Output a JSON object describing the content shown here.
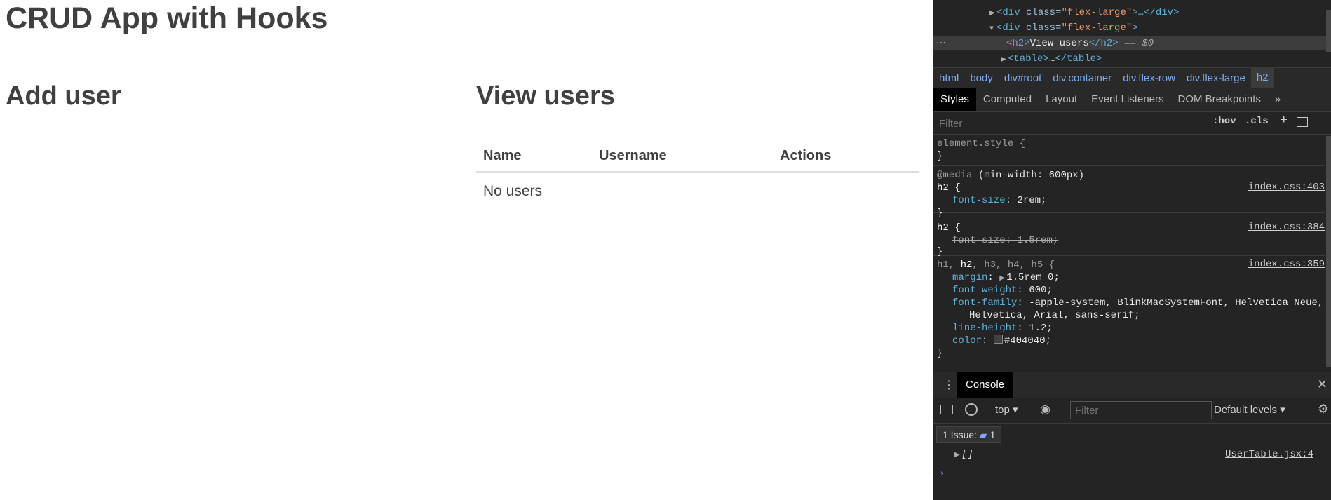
{
  "app": {
    "title": "CRUD App with Hooks",
    "add_heading": "Add user",
    "view_heading": "View users",
    "table": {
      "headers": [
        "Name",
        "Username",
        "Actions"
      ],
      "empty_message": "No users"
    }
  },
  "devtools": {
    "dom": {
      "line1": {
        "tag_open": "<div ",
        "attr": "class=",
        "value": "\"flex-large\"",
        "rest": ">…</div>"
      },
      "line2": {
        "tag_open": "<div ",
        "attr": "class=",
        "value": "\"flex-large\"",
        "close": ">"
      },
      "line3": {
        "open": "<h2>",
        "text": "View users",
        "close": "</h2>",
        "eq": " == ",
        "ref": "$0"
      },
      "line4": {
        "tag": "<table>",
        "ellipsis": "…",
        "close": "</table>"
      }
    },
    "breadcrumbs": [
      "html",
      "body",
      "div#root",
      "div.container",
      "div.flex-row",
      "div.flex-large",
      "h2"
    ],
    "tabs": [
      "Styles",
      "Computed",
      "Layout",
      "Event Listeners",
      "DOM Breakpoints"
    ],
    "tabs_more": "»",
    "styles_filter_placeholder": "Filter",
    "hov": ":hov",
    "cls": ".cls",
    "plus": "+",
    "rules": {
      "element_style": "element.style {",
      "close": "}",
      "media": "@media",
      "media_query": " (min-width: 600px)",
      "rule1": {
        "selector": "h2 {",
        "source": "index.css:403",
        "prop": "font-size",
        "value": "2rem;"
      },
      "rule2": {
        "selector": "h2 {",
        "source": "index.css:384",
        "prop": "font-size",
        "value": "1.5rem;"
      },
      "rule3": {
        "sel_h1": "h1, ",
        "sel_h2": "h2",
        "sel_rest": ", h3, h4, h5 {",
        "source": "index.css:359",
        "margin_prop": "margin",
        "margin_val": "1.5rem 0;",
        "fw_prop": "font-weight",
        "fw_val": "600;",
        "ff_prop": "font-family",
        "ff_val1": "-apple-system, BlinkMacSystemFont, Helvetica Neue,",
        "ff_val2": "Helvetica, Arial, sans-serif;",
        "lh_prop": "line-height",
        "lh_val": "1.2;",
        "color_prop": "color",
        "color_val": "#404040;"
      }
    },
    "console": {
      "tab": "Console",
      "context": "top",
      "filter_placeholder": "Filter",
      "levels": "Default levels",
      "issues_label": "1 Issue:",
      "issues_count": "1",
      "log_value": "[]",
      "log_source": "UserTable.jsx:4",
      "prompt": "›"
    }
  }
}
